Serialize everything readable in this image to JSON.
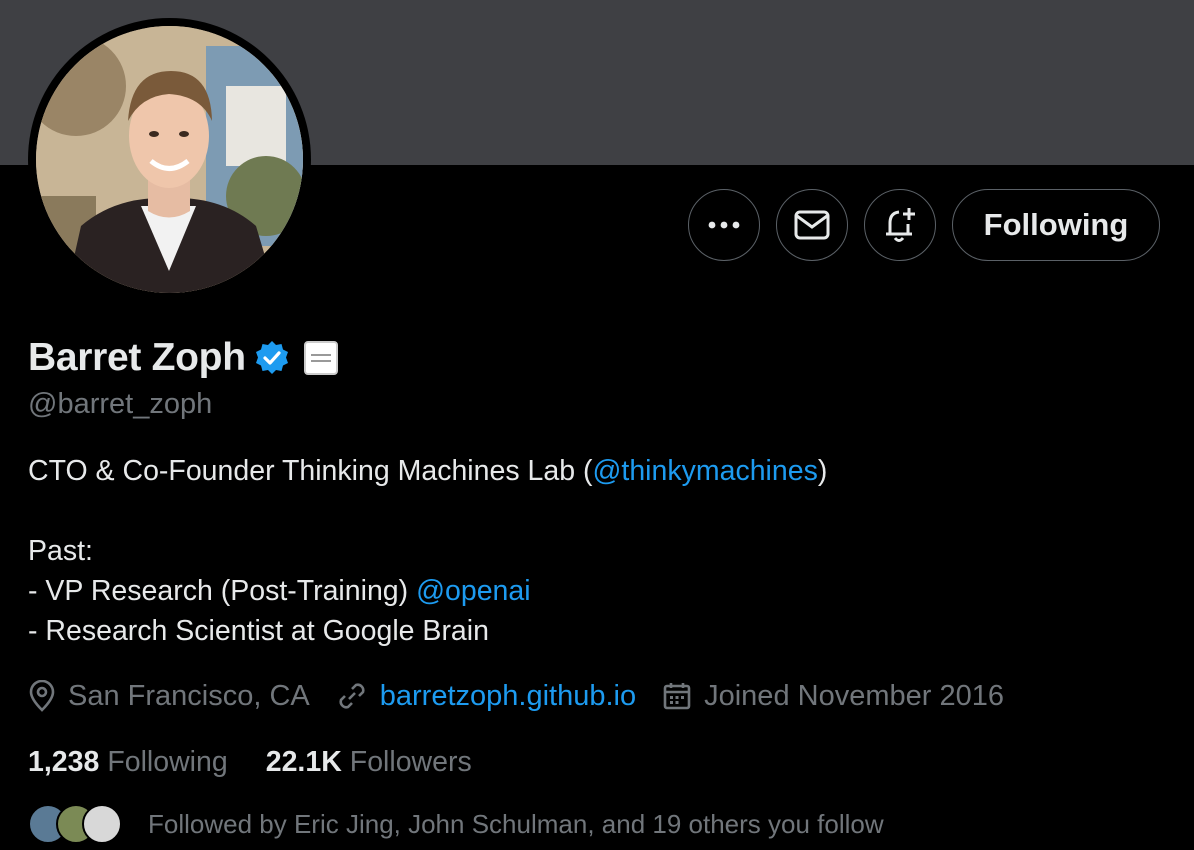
{
  "profile": {
    "name": "Barret Zoph",
    "handle": "@barret_zoph",
    "verified_color": "#1d9bf0"
  },
  "actions": {
    "more_icon": "more-icon",
    "message_icon": "mail-icon",
    "notify_icon": "bell-plus-icon",
    "following_label": "Following"
  },
  "bio": {
    "line1_prefix": "CTO & Co-Founder Thinking Machines Lab (",
    "line1_mention": "@thinkymachines",
    "line1_suffix": ")",
    "past_label": "Past:",
    "line2_prefix": "- VP Research (Post-Training) ",
    "line2_mention": "@openai",
    "line3": "- Research Scientist at Google Brain"
  },
  "meta": {
    "location": "San Francisco, CA",
    "website": "barretzoph.github.io",
    "joined": "Joined November 2016"
  },
  "stats": {
    "following_count": "1,238",
    "following_label": "Following",
    "followers_count": "22.1K",
    "followers_label": "Followers"
  },
  "followed_by": {
    "text": "Followed by Eric Jing, John Schulman, and 19 others you follow"
  },
  "colors": {
    "banner": "#3f4044",
    "background": "#000000",
    "text_primary": "#e7e9ea",
    "text_secondary": "#71767b",
    "link": "#1d9bf0"
  }
}
